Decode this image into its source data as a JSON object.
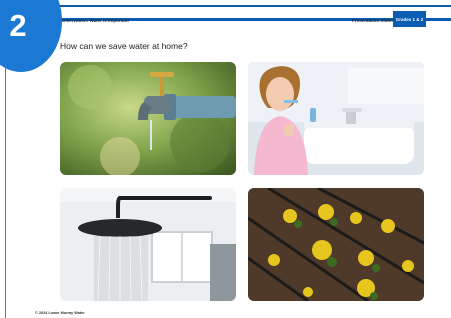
{
  "header": {
    "topic": "Conservation: Water is Important",
    "slide_type": "Presentation Slides",
    "grade_badge": "Grades 1 & 2"
  },
  "slide": {
    "number": "2",
    "question": "How can we save water at home?"
  },
  "photos": [
    {
      "subject": "dripping-faucet"
    },
    {
      "subject": "girl-brushing-teeth"
    },
    {
      "subject": "shower-head"
    },
    {
      "subject": "garden-drip-irrigation"
    }
  ],
  "footer": {
    "copyright": "© 2024 Lower Murray Water"
  },
  "colors": {
    "brand_blue": "#0a5db3",
    "circle_blue": "#1b79d3"
  }
}
